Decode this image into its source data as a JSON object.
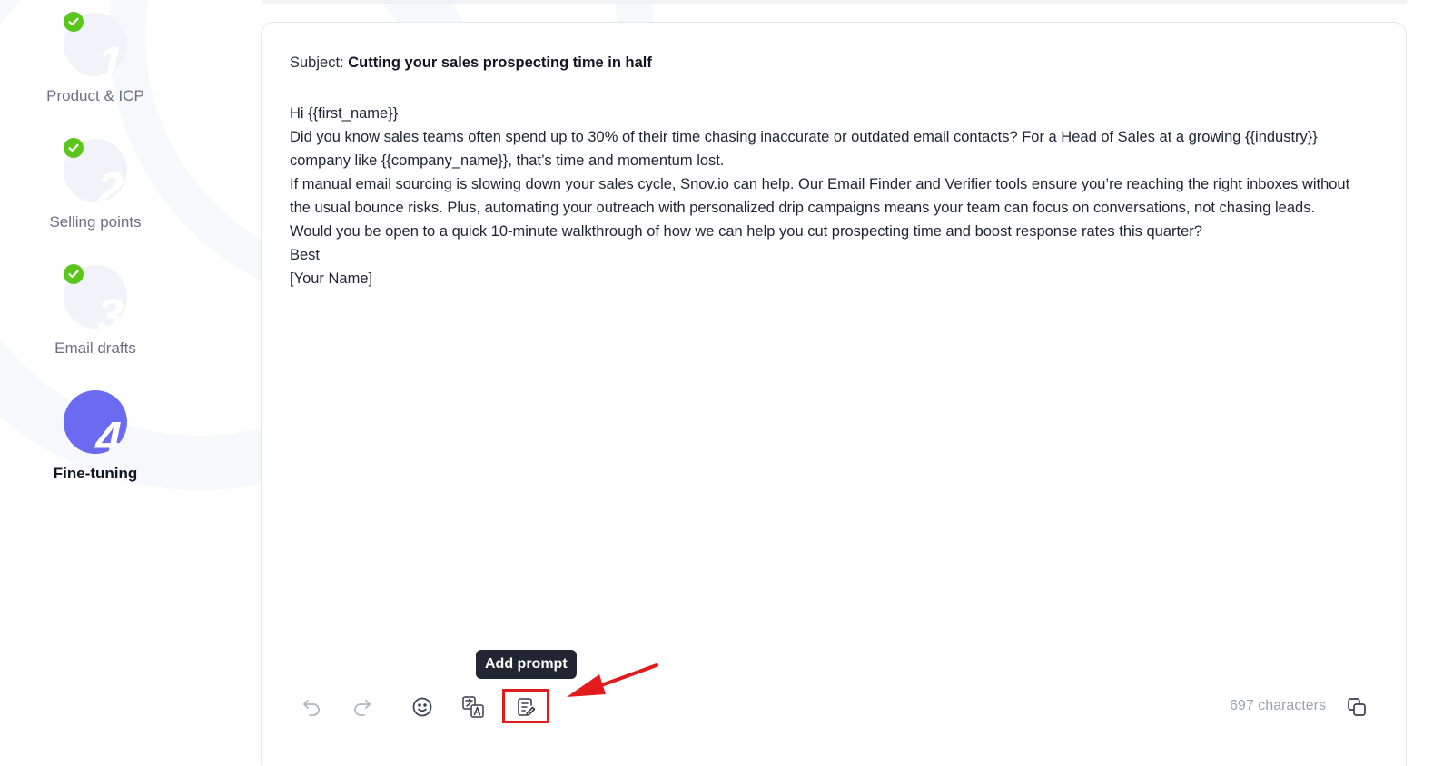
{
  "stepper": {
    "steps": [
      {
        "number": "1",
        "label": "Product & ICP",
        "completed": true,
        "active": false
      },
      {
        "number": "2",
        "label": "Selling points",
        "completed": true,
        "active": false
      },
      {
        "number": "3",
        "label": "Email drafts",
        "completed": true,
        "active": false
      },
      {
        "number": "4",
        "label": "Fine-tuning",
        "completed": false,
        "active": true
      }
    ]
  },
  "email": {
    "subject_prefix": "Subject:",
    "subject": "Cutting your sales prospecting time in half",
    "lines": [
      "Hi {{first_name}}",
      "Did you know sales teams often spend up to 30% of their time chasing inaccurate or outdated email contacts? For a Head of Sales at a growing {{industry}} company like {{company_name}}, that’s time and momentum lost.",
      "If manual email sourcing is slowing down your sales cycle, Snov.io can help. Our Email Finder and Verifier tools ensure you’re reaching the right inboxes without the usual bounce risks. Plus, automating your outreach with personalized drip campaigns means your team can focus on conversations, not chasing leads.",
      "Would you be open to a quick 10-minute walkthrough of how we can help you cut prospecting time and boost response rates this quarter?",
      "Best",
      "[Your Name]"
    ]
  },
  "toolbar": {
    "tooltip": "Add prompt",
    "char_count": "697 characters",
    "icons": [
      "undo-icon",
      "redo-icon",
      "emoji-icon",
      "translate-icon",
      "add-prompt-icon",
      "copy-icon"
    ]
  },
  "colors": {
    "accent": "#6a6bf0",
    "check": "#5ac61c",
    "annotation": "#e21c1c"
  }
}
